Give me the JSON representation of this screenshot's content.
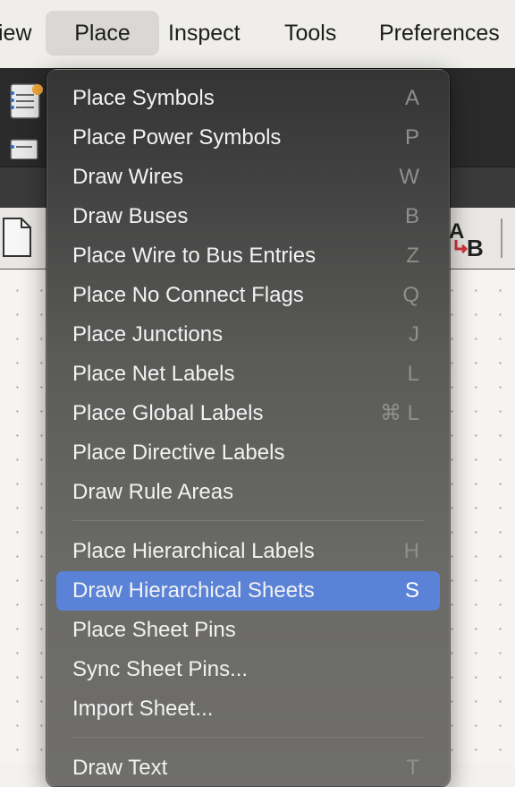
{
  "menubar": {
    "items": [
      {
        "label": "iew"
      },
      {
        "label": "Place"
      },
      {
        "label": "Inspect"
      },
      {
        "label": "Tools"
      },
      {
        "label": "Preferences"
      }
    ]
  },
  "place_menu": {
    "group1": [
      {
        "label": "Place Symbols",
        "shortcut": "A"
      },
      {
        "label": "Place Power Symbols",
        "shortcut": "P"
      },
      {
        "label": "Draw Wires",
        "shortcut": "W"
      },
      {
        "label": "Draw Buses",
        "shortcut": "B"
      },
      {
        "label": "Place Wire to Bus Entries",
        "shortcut": "Z"
      },
      {
        "label": "Place No Connect Flags",
        "shortcut": "Q"
      },
      {
        "label": "Place Junctions",
        "shortcut": "J"
      },
      {
        "label": "Place Net Labels",
        "shortcut": "L"
      },
      {
        "label": "Place Global Labels",
        "shortcut": "⌘ L"
      },
      {
        "label": "Place Directive Labels",
        "shortcut": ""
      },
      {
        "label": "Draw Rule Areas",
        "shortcut": ""
      }
    ],
    "group2": [
      {
        "label": "Place Hierarchical Labels",
        "shortcut": "H"
      },
      {
        "label": "Draw Hierarchical Sheets",
        "shortcut": "S"
      },
      {
        "label": "Place Sheet Pins",
        "shortcut": ""
      },
      {
        "label": "Sync Sheet Pins...",
        "shortcut": ""
      },
      {
        "label": "Import Sheet...",
        "shortcut": ""
      }
    ],
    "group3": [
      {
        "label": "Draw Text",
        "shortcut": "T"
      }
    ],
    "highlighted": "Draw Hierarchical Sheets"
  },
  "toolbar": {
    "ab_icon": "A→B"
  },
  "icons": {
    "symbol_editor": "symbol-editor-icon",
    "sheet_icon": "sheet-icon",
    "text_replace": "text-replace-icon"
  },
  "colors": {
    "highlight": "#5a82d6",
    "menu_bg_top": "#343434",
    "menu_bg_bottom": "#6f6e6b",
    "menubar_active": "#d9d8d4"
  }
}
